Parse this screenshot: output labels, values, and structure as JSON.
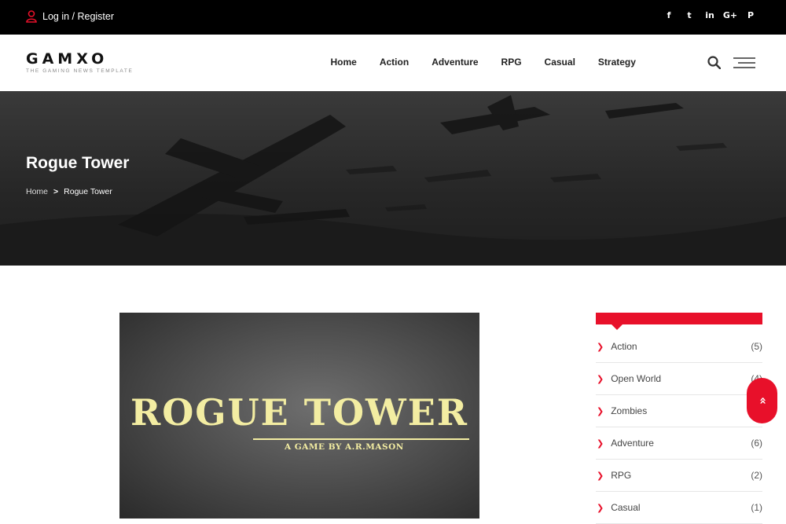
{
  "topbar": {
    "login_label": "Log in / Register",
    "socials": [
      "facebook-icon",
      "twitter-icon",
      "linkedin-icon",
      "google-plus-icon",
      "pinterest-icon"
    ],
    "social_glyphs": [
      "f",
      "t",
      "in",
      "G+",
      "P"
    ]
  },
  "header": {
    "logo_text": "GAMXO",
    "logo_tagline": "THE GAMING NEWS TEMPLATE",
    "nav": [
      "Home",
      "Action",
      "Adventure",
      "RPG",
      "Casual",
      "Strategy"
    ]
  },
  "hero": {
    "title": "Rogue Tower",
    "breadcrumb_home": "Home",
    "breadcrumb_sep": ">",
    "breadcrumb_current": "Rogue Tower"
  },
  "article": {
    "art_title": "ROGUE TOWER",
    "art_byline": "A GAME BY A.R.MASON"
  },
  "sidebar": {
    "categories": [
      {
        "label": "Action",
        "count": "(5)"
      },
      {
        "label": "Open World",
        "count": "(4)"
      },
      {
        "label": "Zombies",
        "count": ""
      },
      {
        "label": "Adventure",
        "count": "(6)"
      },
      {
        "label": "RPG",
        "count": "(2)"
      },
      {
        "label": "Casual",
        "count": "(1)"
      }
    ]
  },
  "colors": {
    "accent": "#e8102a",
    "topbar": "#000000",
    "art_text": "#f3eda2"
  },
  "scroll_top_glyph": "»"
}
